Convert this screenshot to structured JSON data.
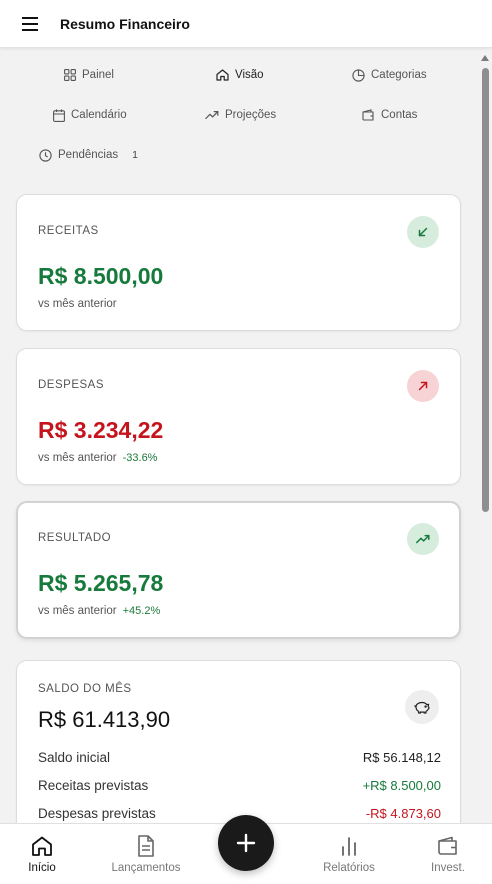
{
  "header": {
    "title": "Resumo Financeiro",
    "menu_icon": "hamburger-menu-icon"
  },
  "nav": {
    "items": [
      {
        "label": "Painel",
        "icon": "grid-icon"
      },
      {
        "label": "Visão",
        "icon": "home-icon",
        "active": true
      },
      {
        "label": "Categorias",
        "icon": "pie-chart-icon"
      },
      {
        "label": "Calendário",
        "icon": "calendar-icon"
      },
      {
        "label": "Projeções",
        "icon": "trending-up-icon"
      },
      {
        "label": "Contas",
        "icon": "wallet-icon"
      },
      {
        "label": "Pendências",
        "icon": "clock-icon",
        "badge": "1"
      }
    ]
  },
  "cards": {
    "receitas": {
      "label": "RECEITAS",
      "value": "R$ 8.500,00",
      "sub": "vs mês anterior",
      "delta": "",
      "icon": "arrow-down-left-icon",
      "color": "#177a3c"
    },
    "despesas": {
      "label": "DESPESAS",
      "value": "R$ 3.234,22",
      "sub": "vs mês anterior",
      "delta": "-33.6%",
      "icon": "arrow-up-right-icon",
      "color": "#c5141d"
    },
    "resultado": {
      "label": "RESULTADO",
      "value": "R$ 5.265,78",
      "sub": "vs mês anterior",
      "delta": "+45.2%",
      "icon": "trending-up-icon",
      "color": "#177a3c"
    }
  },
  "balance": {
    "label": "SALDO DO MÊS",
    "value": "R$ 61.413,90",
    "icon": "piggy-bank-icon",
    "rows": [
      {
        "label": "Saldo inicial",
        "value": "R$ 56.148,12",
        "color": "#222222"
      },
      {
        "label": "Receitas previstas",
        "value": "+R$ 8.500,00",
        "color": "#177a3c"
      },
      {
        "label": "Despesas previstas",
        "value": "-R$ 4.873,60",
        "color": "#c5141d"
      }
    ]
  },
  "bottom_nav": {
    "items": [
      {
        "label": "Início",
        "icon": "home-icon",
        "active": true
      },
      {
        "label": "Lançamentos",
        "icon": "document-icon"
      },
      {
        "label": "Relatórios",
        "icon": "bar-chart-icon"
      },
      {
        "label": "Invest.",
        "icon": "wallet-icon"
      }
    ],
    "fab_icon": "plus-icon"
  }
}
